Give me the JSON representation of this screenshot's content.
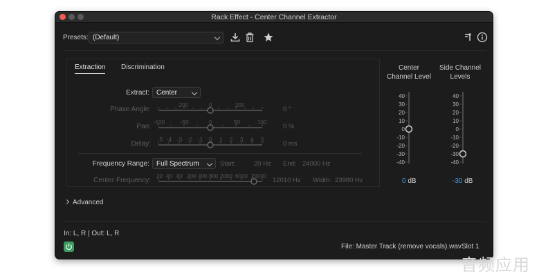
{
  "window": {
    "title": "Rack Effect - Center Channel Extractor"
  },
  "presets": {
    "label": "Presets:",
    "selected": "(Default)"
  },
  "toolbar_icons": [
    "download-icon",
    "trash-icon",
    "star-icon",
    "routing-icon",
    "info-icon"
  ],
  "tabs": [
    {
      "label": "Extraction",
      "active": true
    },
    {
      "label": "Discrimination",
      "active": false
    }
  ],
  "extraction": {
    "extract": {
      "label": "Extract:",
      "value": "Center"
    },
    "phase_angle": {
      "label": "Phase Angle:",
      "scale": [
        "-200",
        "0",
        "200"
      ],
      "value_text": "0 °",
      "position": 0.5
    },
    "pan": {
      "label": "Pan:",
      "scale": [
        "-100",
        "-50",
        "0",
        "50",
        "100"
      ],
      "value_text": "0 %",
      "position": 0.5
    },
    "delay": {
      "label": "Delay:",
      "scale": [
        "-5",
        "-4",
        "-3",
        "-2",
        "-1",
        "0",
        "1",
        "2",
        "3",
        "4",
        "5"
      ],
      "value_text": "0 ms",
      "position": 0.5
    },
    "frequency_range": {
      "label": "Frequency Range:",
      "value": "Full Spectrum",
      "start_label": "Start:",
      "start_value": "20 Hz",
      "end_label": "End:",
      "end_value": "24000 Hz"
    },
    "center_frequency": {
      "label": "Center Frequency:",
      "scale": [
        "20",
        "40",
        "80",
        "200",
        "400",
        "800",
        "2000",
        "6000",
        "20000"
      ],
      "value_text": "12010 Hz",
      "width_label": "Width:",
      "width_value": "23980 Hz",
      "position": 0.93
    }
  },
  "advanced": {
    "label": "Advanced"
  },
  "meters": {
    "center": {
      "title_line1": "Center",
      "title_line2": "Channel Level",
      "scale": [
        "40",
        "30",
        "20",
        "10",
        "0",
        "-10",
        "-20",
        "-30",
        "-40"
      ],
      "value": "0",
      "unit": "dB",
      "level_db": 0
    },
    "side": {
      "title_line1": "Side Channel",
      "title_line2": "Levels",
      "scale": [
        "40",
        "30",
        "20",
        "10",
        "0",
        "-10",
        "-20",
        "-30",
        "-40"
      ],
      "value": "-30",
      "unit": "dB",
      "level_db": -30
    }
  },
  "footer": {
    "io": "In: L, R | Out: L, R",
    "file": "File: Master Track (remove vocals).wav",
    "slot": "Slot 1"
  },
  "watermark": "音频应用",
  "colors": {
    "window_bg": "#1c1c1c",
    "accent_blue": "#3b9ff3",
    "power_green": "#3b9b61",
    "close_red": "#ee5c55"
  }
}
